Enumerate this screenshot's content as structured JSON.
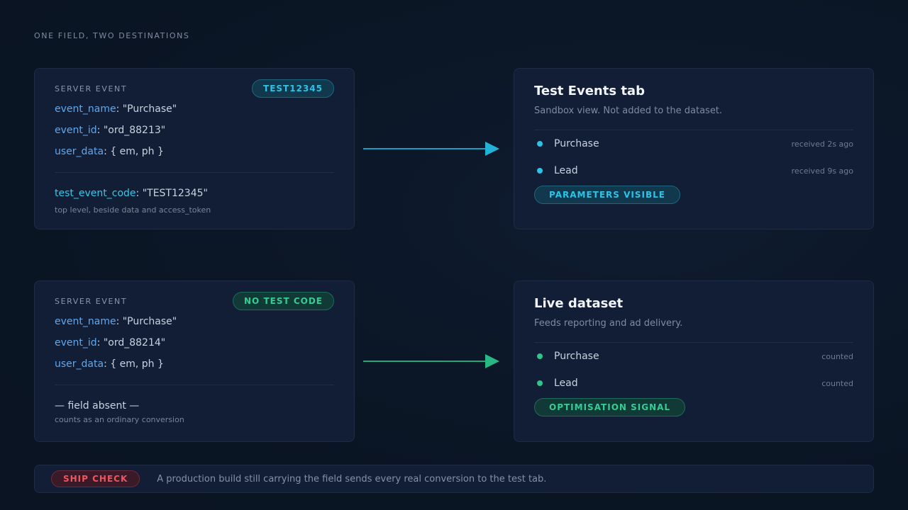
{
  "heading": "ONE FIELD, TWO DESTINATIONS",
  "colors": {
    "cyan": "#2ec3e6",
    "green": "#35cc95",
    "red": "#f0555f",
    "background": "#0b1626"
  },
  "test_event": {
    "kicker": "SERVER EVENT",
    "badge": "TEST12345",
    "lines": [
      {
        "key": "event_name",
        "value": ": \"Purchase\""
      },
      {
        "key": "event_id",
        "value": ": \"ord_88213\""
      },
      {
        "key": "user_data",
        "value": ": { em, ph }"
      }
    ],
    "field": {
      "key": "test_event_code",
      "value": ": \"TEST12345\""
    },
    "note": "top level, beside data and access_token"
  },
  "live_event": {
    "kicker": "SERVER EVENT",
    "badge": "NO TEST CODE",
    "lines": [
      {
        "key": "event_name",
        "value": ": \"Purchase\""
      },
      {
        "key": "event_id",
        "value": ": \"ord_88214\""
      },
      {
        "key": "user_data",
        "value": ": { em, ph }"
      }
    ],
    "absent": "— field absent —",
    "note": "counts as an ordinary conversion"
  },
  "test_tab": {
    "title": "Test Events tab",
    "subtitle": "Sandbox view. Not added to the dataset.",
    "events": [
      {
        "name": "Purchase",
        "status": "received 2s ago"
      },
      {
        "name": "Lead",
        "status": "received 9s ago"
      }
    ],
    "badge": "PARAMETERS VISIBLE"
  },
  "live_dataset": {
    "title": "Live dataset",
    "subtitle": "Feeds reporting and ad delivery.",
    "events": [
      {
        "name": "Purchase",
        "status": "counted"
      },
      {
        "name": "Lead",
        "status": "counted"
      }
    ],
    "badge": "OPTIMISATION SIGNAL"
  },
  "ship_check": {
    "badge": "SHIP CHECK",
    "text": "A production build still carrying the field sends every real conversion to the test tab."
  },
  "icons": {
    "arrow": "arrow-right-icon",
    "status_dot": "status-dot-icon"
  }
}
